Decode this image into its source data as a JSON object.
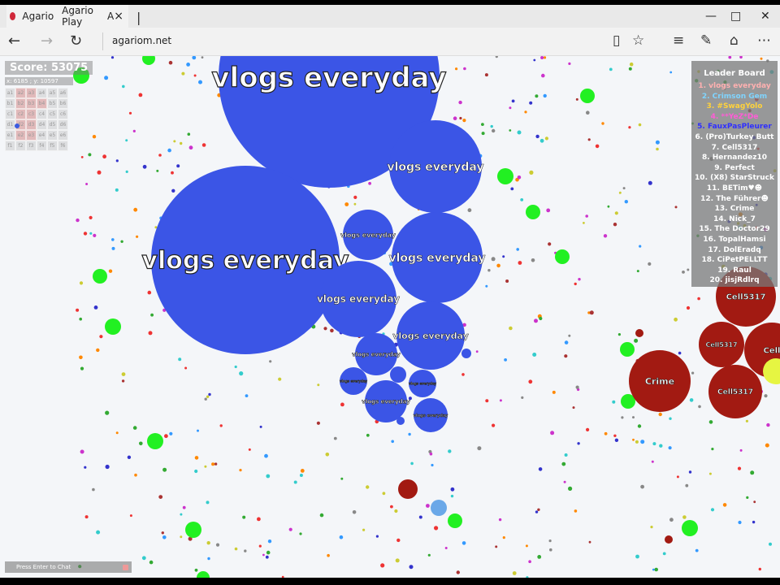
{
  "browser": {
    "tab_title_1": "Agario",
    "tab_title_2": "Agario Play",
    "tab_title_3": "A",
    "tab_close": "×",
    "new_tab": "|",
    "minimize": "—",
    "maximize": "□",
    "close": "✕",
    "address": "agariom.net"
  },
  "hud": {
    "score": "Score: 53075",
    "coords": "x: 6185 ; y: 10597",
    "minimap_cells": [
      "a1",
      "a2",
      "a3",
      "a4",
      "a5",
      "a6",
      "b1",
      "b2",
      "b3",
      "b4",
      "b5",
      "b6",
      "c1",
      "c2",
      "c3",
      "c4",
      "c5",
      "c6",
      "d1",
      "d2",
      "d3",
      "d4",
      "d5",
      "d6",
      "e1",
      "e2",
      "e3",
      "e4",
      "e5",
      "e6",
      "f1",
      "f2",
      "f3",
      "f4",
      "f5",
      "f6"
    ],
    "chat_placeholder": "Press Enter to Chat"
  },
  "leaderboard": {
    "title": "Leader Board",
    "entries": [
      {
        "label": "1. vlogs everyday",
        "color": "#ffb0b0"
      },
      {
        "label": "2. Crimson Gem",
        "color": "#7fd4ff"
      },
      {
        "label": "3. #SwagYolo",
        "color": "#ffd23a"
      },
      {
        "label": "4. **YeZ*De",
        "color": "#ff5cd6"
      },
      {
        "label": "5. FauxPasPleurer",
        "color": "#2f2fff"
      },
      {
        "label": "6. (Pro)Turkey Butt",
        "color": "#ffffff"
      },
      {
        "label": "7. Cell5317",
        "color": "#ffffff"
      },
      {
        "label": "8. Hernandez10",
        "color": "#ffffff"
      },
      {
        "label": "9. Perfect",
        "color": "#ffffff"
      },
      {
        "label": "10. (X8) StarStruck",
        "color": "#ffffff"
      },
      {
        "label": "11. BETim♥☻",
        "color": "#ffffff"
      },
      {
        "label": "12. The Führer☻",
        "color": "#ffffff"
      },
      {
        "label": "13. Crime",
        "color": "#ffffff"
      },
      {
        "label": "14. Nick_7",
        "color": "#ffffff"
      },
      {
        "label": "15. The Doctor29",
        "color": "#ffffff"
      },
      {
        "label": "16. TopalHamsi",
        "color": "#ffffff"
      },
      {
        "label": "17. DolEradq",
        "color": "#ffffff"
      },
      {
        "label": "18. CiPetPELLTT",
        "color": "#ffffff"
      },
      {
        "label": "19. Raul",
        "color": "#ffffff"
      },
      {
        "label": "20. jisjRdlrq",
        "color": "#ffffff"
      }
    ]
  },
  "cells": {
    "player_name": "vlogs everyday",
    "player_color": "#3b55e6",
    "enemy_color": "#a21a12",
    "virus_color": "#22f022",
    "enemy_names": [
      "Cell5317",
      "Cell5317",
      "Cell5317",
      "Cell",
      "Crime",
      "Cell5317"
    ]
  }
}
